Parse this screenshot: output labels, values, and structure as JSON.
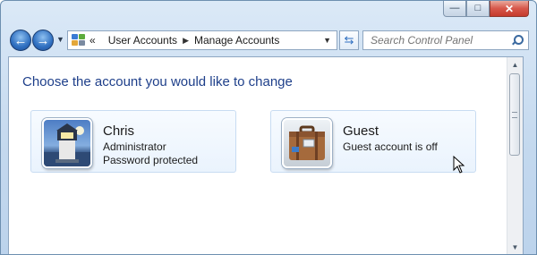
{
  "window": {
    "caption_buttons": [
      "minimize-icon",
      "maximize-icon",
      "close-icon"
    ]
  },
  "nav": {
    "back_icon": "back-arrow-icon",
    "forward_icon": "forward-arrow-icon",
    "recent_pages_icon": "chevron-down-icon"
  },
  "address_bar": {
    "overflow": "«",
    "crumbs": [
      "User Accounts",
      "Manage Accounts"
    ],
    "icon": "control-panel-icon"
  },
  "search": {
    "placeholder": "Search Control Panel",
    "icon": "search-icon"
  },
  "content": {
    "heading": "Choose the account you would like to change",
    "accounts": [
      {
        "name": "Chris",
        "lines": [
          "Administrator",
          "Password protected"
        ],
        "picture": "lighthouse-icon"
      },
      {
        "name": "Guest",
        "lines": [
          "Guest account is off"
        ],
        "picture": "suitcase-icon"
      }
    ]
  },
  "colors": {
    "heading": "#1e3f8a",
    "frame": "#c3d8ee",
    "tile_border": "#c8dcf2",
    "close": "#c43a2c"
  }
}
